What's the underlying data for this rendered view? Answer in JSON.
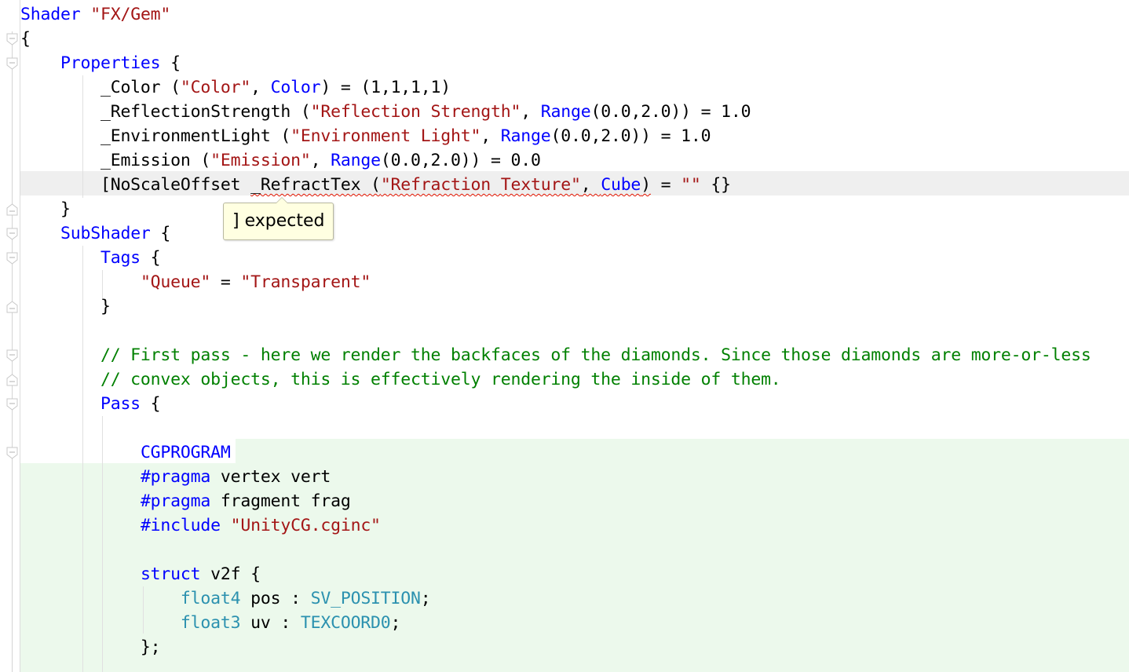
{
  "editor": {
    "language": "ShaderLab",
    "current_line_index": 7,
    "lines": [
      [
        {
          "t": "Shader ",
          "c": "kw"
        },
        {
          "t": "\"FX/Gem\"",
          "c": "str"
        }
      ],
      [
        {
          "t": "{",
          "c": ""
        }
      ],
      [
        {
          "t": "    ",
          "c": ""
        },
        {
          "t": "Properties",
          "c": "kw"
        },
        {
          "t": " {",
          "c": ""
        }
      ],
      [
        {
          "t": "        _Color (",
          "c": ""
        },
        {
          "t": "\"Color\"",
          "c": "str"
        },
        {
          "t": ", ",
          "c": ""
        },
        {
          "t": "Color",
          "c": "kw"
        },
        {
          "t": ") = (1,1,1,1)",
          "c": ""
        }
      ],
      [
        {
          "t": "        _ReflectionStrength (",
          "c": ""
        },
        {
          "t": "\"Reflection Strength\"",
          "c": "str"
        },
        {
          "t": ", ",
          "c": ""
        },
        {
          "t": "Range",
          "c": "kw"
        },
        {
          "t": "(0.0,2.0)) = 1.0",
          "c": ""
        }
      ],
      [
        {
          "t": "        _EnvironmentLight (",
          "c": ""
        },
        {
          "t": "\"Environment Light\"",
          "c": "str"
        },
        {
          "t": ", ",
          "c": ""
        },
        {
          "t": "Range",
          "c": "kw"
        },
        {
          "t": "(0.0,2.0)) = 1.0",
          "c": ""
        }
      ],
      [
        {
          "t": "        _Emission (",
          "c": ""
        },
        {
          "t": "\"Emission\"",
          "c": "str"
        },
        {
          "t": ", ",
          "c": ""
        },
        {
          "t": "Range",
          "c": "kw"
        },
        {
          "t": "(0.0,2.0)) = 0.0",
          "c": ""
        }
      ],
      [
        {
          "t": "        [NoScaleOffset ",
          "c": ""
        },
        {
          "t": "_RefractTex (",
          "c": "",
          "e": true
        },
        {
          "t": "\"Refraction Texture\"",
          "c": "str",
          "e": true
        },
        {
          "t": ", ",
          "c": "",
          "e": true
        },
        {
          "t": "Cube",
          "c": "kw",
          "e": true
        },
        {
          "t": ")",
          "c": "",
          "e": true
        },
        {
          "t": " = ",
          "c": ""
        },
        {
          "t": "\"\"",
          "c": "str"
        },
        {
          "t": " {}",
          "c": ""
        }
      ],
      [
        {
          "t": "    }",
          "c": ""
        }
      ],
      [
        {
          "t": "    ",
          "c": ""
        },
        {
          "t": "SubShader",
          "c": "kw"
        },
        {
          "t": " {",
          "c": ""
        }
      ],
      [
        {
          "t": "        ",
          "c": ""
        },
        {
          "t": "Tags",
          "c": "kw"
        },
        {
          "t": " {",
          "c": ""
        }
      ],
      [
        {
          "t": "            ",
          "c": ""
        },
        {
          "t": "\"Queue\"",
          "c": "str"
        },
        {
          "t": " = ",
          "c": ""
        },
        {
          "t": "\"Transparent\"",
          "c": "str"
        }
      ],
      [
        {
          "t": "        }",
          "c": ""
        }
      ],
      [
        {
          "t": "",
          "c": ""
        }
      ],
      [
        {
          "t": "        ",
          "c": ""
        },
        {
          "t": "// First pass - here we render the backfaces of the diamonds. Since those diamonds are more-or-less",
          "c": "cm"
        }
      ],
      [
        {
          "t": "        ",
          "c": ""
        },
        {
          "t": "// convex objects, this is effectively rendering the inside of them.",
          "c": "cm"
        }
      ],
      [
        {
          "t": "        ",
          "c": ""
        },
        {
          "t": "Pass",
          "c": "kw"
        },
        {
          "t": " {",
          "c": ""
        }
      ],
      [
        {
          "t": "",
          "c": ""
        }
      ],
      [
        {
          "t": "            ",
          "c": ""
        },
        {
          "t": "CGPROGRAM",
          "c": "kw"
        }
      ],
      [
        {
          "t": "            ",
          "c": ""
        },
        {
          "t": "#pragma",
          "c": "kw"
        },
        {
          "t": " vertex vert",
          "c": ""
        }
      ],
      [
        {
          "t": "            ",
          "c": ""
        },
        {
          "t": "#pragma",
          "c": "kw"
        },
        {
          "t": " fragment frag",
          "c": ""
        }
      ],
      [
        {
          "t": "            ",
          "c": ""
        },
        {
          "t": "#include",
          "c": "kw"
        },
        {
          "t": " ",
          "c": ""
        },
        {
          "t": "\"UnityCG.cginc\"",
          "c": "str"
        }
      ],
      [
        {
          "t": "",
          "c": ""
        }
      ],
      [
        {
          "t": "            ",
          "c": ""
        },
        {
          "t": "struct",
          "c": "kw"
        },
        {
          "t": " v2f {",
          "c": ""
        }
      ],
      [
        {
          "t": "                ",
          "c": ""
        },
        {
          "t": "float4",
          "c": "ty"
        },
        {
          "t": " pos : ",
          "c": ""
        },
        {
          "t": "SV_POSITION",
          "c": "ty"
        },
        {
          "t": ";",
          "c": ""
        }
      ],
      [
        {
          "t": "                ",
          "c": ""
        },
        {
          "t": "float3",
          "c": "ty"
        },
        {
          "t": " uv : ",
          "c": ""
        },
        {
          "t": "TEXCOORD0",
          "c": "ty"
        },
        {
          "t": ";",
          "c": ""
        }
      ],
      [
        {
          "t": "            };",
          "c": ""
        }
      ]
    ]
  },
  "tooltip": {
    "text": "] expected",
    "kind": "error"
  },
  "fold_markers": [
    {
      "line": 1,
      "type": "open"
    },
    {
      "line": 2,
      "type": "open"
    },
    {
      "line": 8,
      "type": "close"
    },
    {
      "line": 9,
      "type": "open"
    },
    {
      "line": 10,
      "type": "open"
    },
    {
      "line": 12,
      "type": "close"
    },
    {
      "line": 14,
      "type": "open"
    },
    {
      "line": 15,
      "type": "close"
    },
    {
      "line": 16,
      "type": "open"
    },
    {
      "line": 18,
      "type": "open"
    }
  ],
  "colors": {
    "keyword": "#0000ff",
    "string": "#a31515",
    "comment": "#008000",
    "type": "#2b91af",
    "error_underline": "#e51400",
    "current_line_bg": "#efefef",
    "changed_region_bg": "#ecf9ec",
    "tooltip_bg": "#ffffe1"
  }
}
